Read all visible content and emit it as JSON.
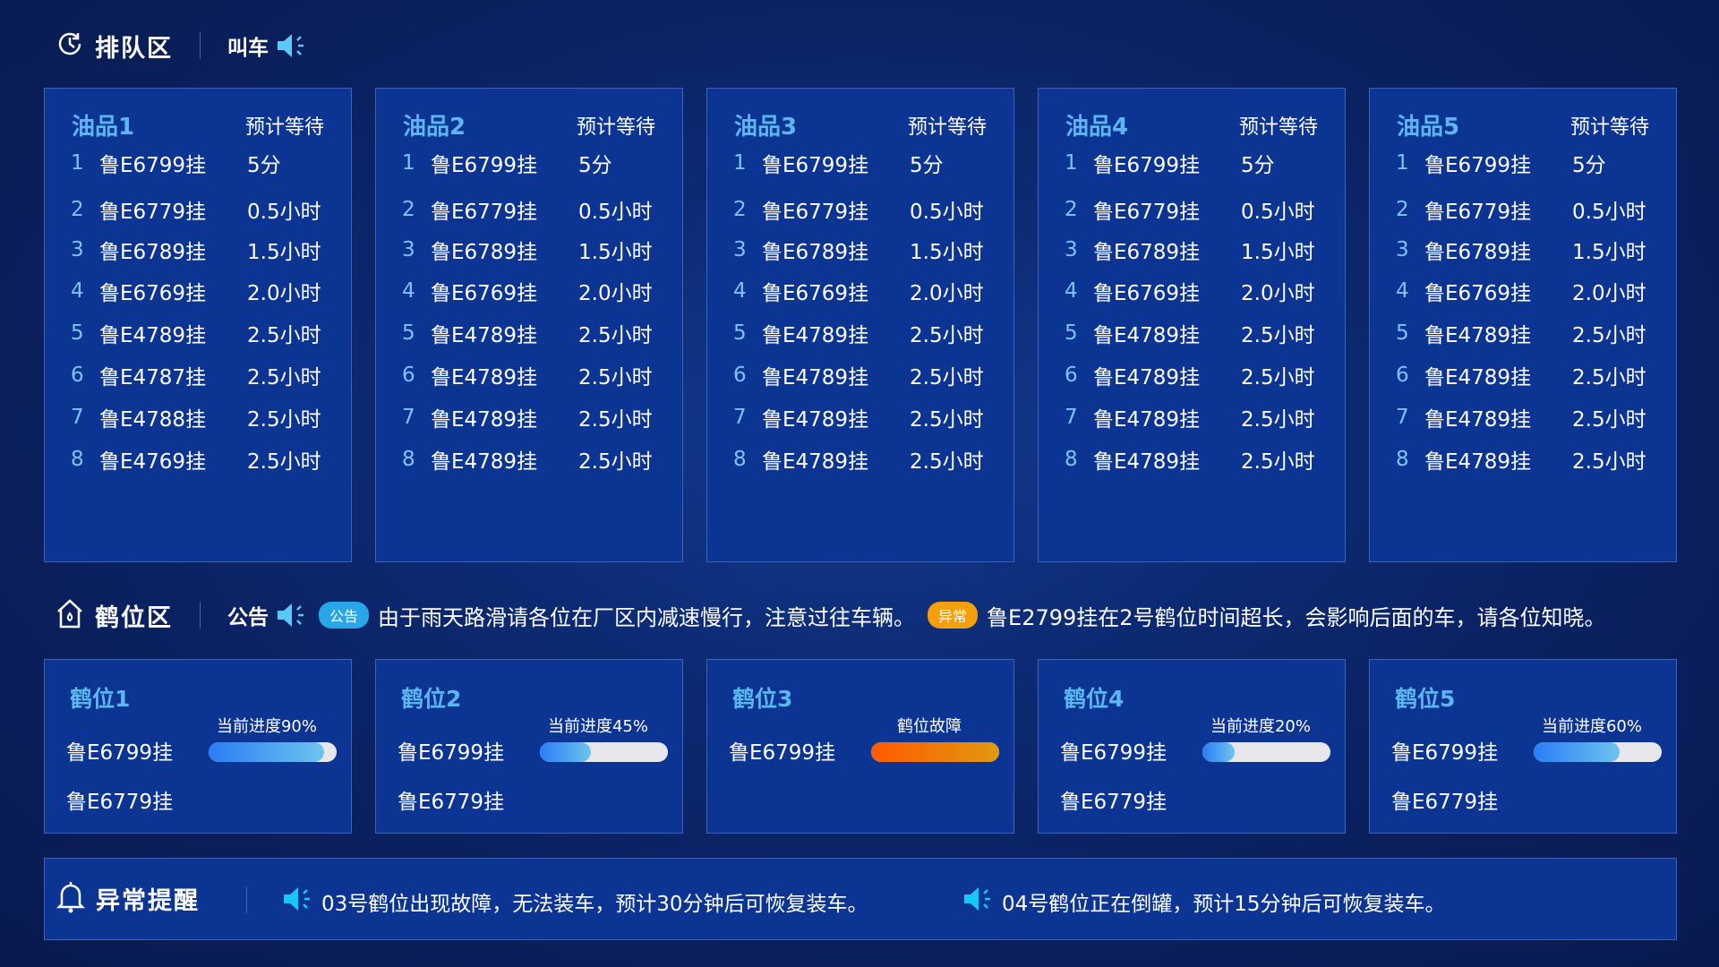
{
  "queue_section": {
    "title": "排队区",
    "call_label": "叫车"
  },
  "queues": [
    {
      "name": "油品1",
      "wait_header": "预计等待",
      "rows": [
        [
          "1",
          "鲁E6799挂",
          "5分"
        ],
        [
          "2",
          "鲁E6779挂",
          "0.5小时"
        ],
        [
          "3",
          "鲁E6789挂",
          "1.5小时"
        ],
        [
          "4",
          "鲁E6769挂",
          "2.0小时"
        ],
        [
          "5",
          "鲁E4789挂",
          "2.5小时"
        ],
        [
          "6",
          "鲁E4787挂",
          "2.5小时"
        ],
        [
          "7",
          "鲁E4788挂",
          "2.5小时"
        ],
        [
          "8",
          "鲁E4769挂",
          "2.5小时"
        ]
      ]
    },
    {
      "name": "油品2",
      "wait_header": "预计等待",
      "rows": [
        [
          "1",
          "鲁E6799挂",
          "5分"
        ],
        [
          "2",
          "鲁E6779挂",
          "0.5小时"
        ],
        [
          "3",
          "鲁E6789挂",
          "1.5小时"
        ],
        [
          "4",
          "鲁E6769挂",
          "2.0小时"
        ],
        [
          "5",
          "鲁E4789挂",
          "2.5小时"
        ],
        [
          "6",
          "鲁E4789挂",
          "2.5小时"
        ],
        [
          "7",
          "鲁E4789挂",
          "2.5小时"
        ],
        [
          "8",
          "鲁E4789挂",
          "2.5小时"
        ]
      ]
    },
    {
      "name": "油品3",
      "wait_header": "预计等待",
      "rows": [
        [
          "1",
          "鲁E6799挂",
          "5分"
        ],
        [
          "2",
          "鲁E6779挂",
          "0.5小时"
        ],
        [
          "3",
          "鲁E6789挂",
          "1.5小时"
        ],
        [
          "4",
          "鲁E6769挂",
          "2.0小时"
        ],
        [
          "5",
          "鲁E4789挂",
          "2.5小时"
        ],
        [
          "6",
          "鲁E4789挂",
          "2.5小时"
        ],
        [
          "7",
          "鲁E4789挂",
          "2.5小时"
        ],
        [
          "8",
          "鲁E4789挂",
          "2.5小时"
        ]
      ]
    },
    {
      "name": "油品4",
      "wait_header": "预计等待",
      "rows": [
        [
          "1",
          "鲁E6799挂",
          "5分"
        ],
        [
          "2",
          "鲁E6779挂",
          "0.5小时"
        ],
        [
          "3",
          "鲁E6789挂",
          "1.5小时"
        ],
        [
          "4",
          "鲁E6769挂",
          "2.0小时"
        ],
        [
          "5",
          "鲁E4789挂",
          "2.5小时"
        ],
        [
          "6",
          "鲁E4789挂",
          "2.5小时"
        ],
        [
          "7",
          "鲁E4789挂",
          "2.5小时"
        ],
        [
          "8",
          "鲁E4789挂",
          "2.5小时"
        ]
      ]
    },
    {
      "name": "油品5",
      "wait_header": "预计等待",
      "rows": [
        [
          "1",
          "鲁E6799挂",
          "5分"
        ],
        [
          "2",
          "鲁E6779挂",
          "0.5小时"
        ],
        [
          "3",
          "鲁E6789挂",
          "1.5小时"
        ],
        [
          "4",
          "鲁E6769挂",
          "2.0小时"
        ],
        [
          "5",
          "鲁E4789挂",
          "2.5小时"
        ],
        [
          "6",
          "鲁E4789挂",
          "2.5小时"
        ],
        [
          "7",
          "鲁E4789挂",
          "2.5小时"
        ],
        [
          "8",
          "鲁E4789挂",
          "2.5小时"
        ]
      ]
    }
  ],
  "crane_section": {
    "title": "鹤位区",
    "notice_label": "公告",
    "notice_badge": "公告",
    "notice_text": "由于雨天路滑请各位在厂区内减速慢行，注意过往车辆。",
    "alert_badge": "异常",
    "alert_text": "鲁E2799挂在2号鹤位时间超长，会影响后面的车，请各位知晓。",
    "notice_badge_color": "#29a6e8",
    "alert_badge_color": "#f5a00a"
  },
  "cranes": [
    {
      "name": "鹤位1",
      "status": "当前进度90%",
      "progress": 0.9,
      "fault": false,
      "plates": [
        "鲁E6799挂",
        "鲁E6779挂"
      ]
    },
    {
      "name": "鹤位2",
      "status": "当前进度45%",
      "progress": 0.4,
      "fault": false,
      "plates": [
        "鲁E6799挂",
        "鲁E6779挂"
      ]
    },
    {
      "name": "鹤位3",
      "status": "鹤位故障",
      "progress": 1,
      "fault": true,
      "plates": [
        "鲁E6799挂"
      ]
    },
    {
      "name": "鹤位4",
      "status": "当前进度20%",
      "progress": 0.25,
      "fault": false,
      "plates": [
        "鲁E6799挂",
        "鲁E6779挂"
      ]
    },
    {
      "name": "鹤位5",
      "status": "当前进度60%",
      "progress": 0.67,
      "fault": false,
      "plates": [
        "鲁E6799挂",
        "鲁E6779挂"
      ]
    }
  ],
  "alarm_section": {
    "title": "异常提醒",
    "messages": [
      "03号鹤位出现故障，无法装车，预计30分钟后可恢复装车。",
      "04号鹤位正在倒罐，预计15分钟后可恢复装车。"
    ]
  }
}
